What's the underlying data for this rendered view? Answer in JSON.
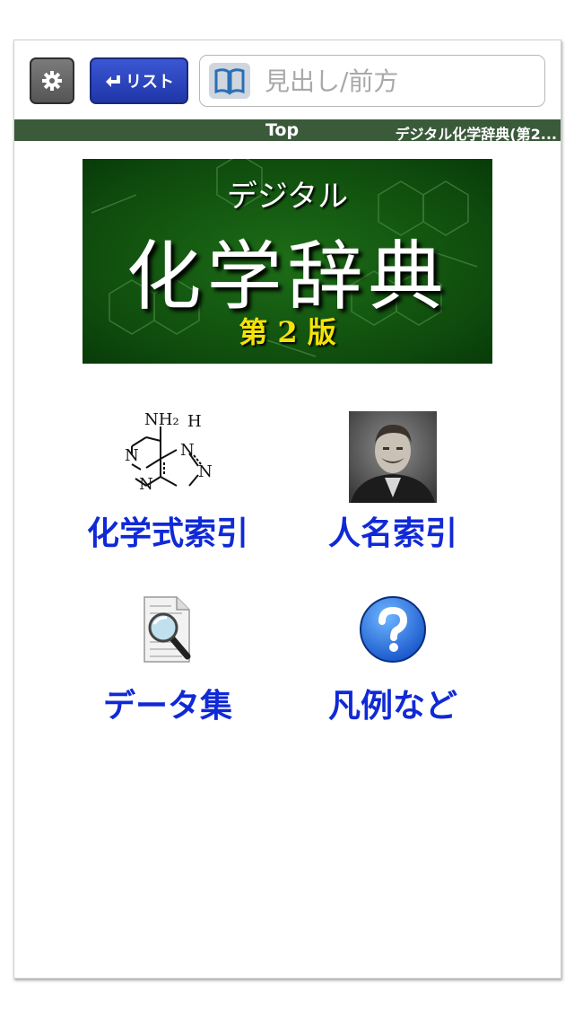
{
  "toolbar": {
    "settings_icon": "gear-icon",
    "list_button_label": "リスト",
    "list_icon": "return-arrow-icon",
    "search_icon": "book-icon",
    "search_placeholder": "見出し/前方"
  },
  "breadcrumb": {
    "current": "Top",
    "dictionary_title": "デジタル化学辞典(第2..."
  },
  "banner": {
    "subtitle": "デジタル",
    "title": "化学辞典",
    "edition": "第 2 版"
  },
  "menu": [
    {
      "label": "化学式索引",
      "icon": "adenine-structure-icon"
    },
    {
      "label": "人名索引",
      "icon": "portrait-photo-icon"
    },
    {
      "label": "データ集",
      "icon": "magnifier-document-icon"
    },
    {
      "label": "凡例など",
      "icon": "help-question-icon"
    }
  ],
  "adenine_labels": {
    "nh2": "NH₂",
    "h": "H",
    "n": "N"
  }
}
